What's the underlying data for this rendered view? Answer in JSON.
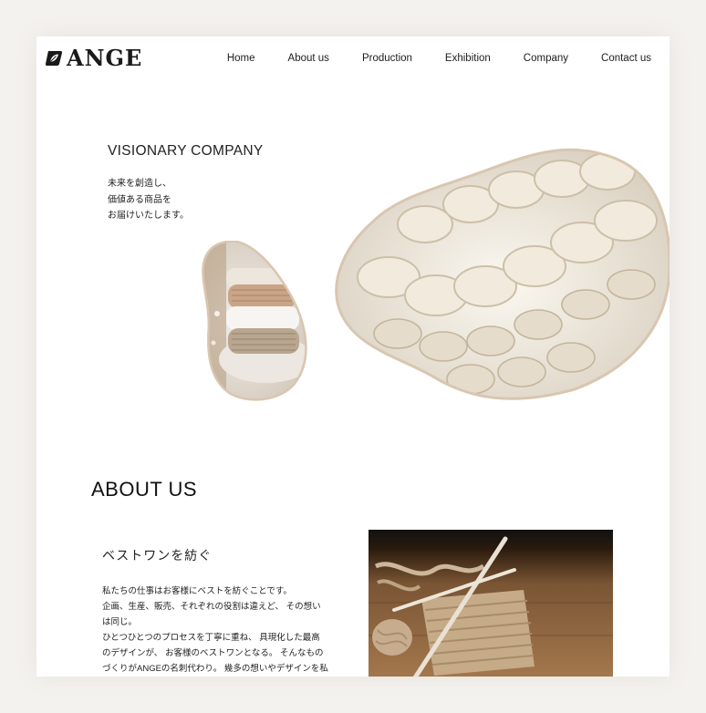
{
  "brand": {
    "name": "ANGE",
    "logo_icon": "leaf-badge-icon"
  },
  "nav": {
    "items": [
      {
        "label": "Home"
      },
      {
        "label": "About us"
      },
      {
        "label": "Production"
      },
      {
        "label": "Exhibition"
      },
      {
        "label": "Company"
      },
      {
        "label": "Contact us"
      }
    ]
  },
  "hero": {
    "title": "VISIONARY COMPANY",
    "lines": [
      "未来を創造し、",
      "価値ある商品を",
      "お届けいたします。"
    ]
  },
  "about": {
    "title": "ABOUT US",
    "subtitle": "ベストワンを紡ぐ",
    "body_lines": [
      "私たちの仕事はお客様にベストを紡ぐことです。",
      "企画、生産、販売、それぞれの役割は違えど、 その想い",
      "は同じ。",
      "ひとつひとつのプロセスを丁寧に重ね、 具現化した最高",
      "のデザインが、 お客様のベストワンとなる。 そんなもの",
      "づくりがANGEの名刺代わり。 幾多の想いやデザインを私"
    ]
  },
  "colors": {
    "background": "#f4f2ef",
    "page": "#ffffff",
    "text": "#1d1d1d",
    "wool_cream": "#efe8db",
    "wood_brown": "#6b4a2e"
  }
}
